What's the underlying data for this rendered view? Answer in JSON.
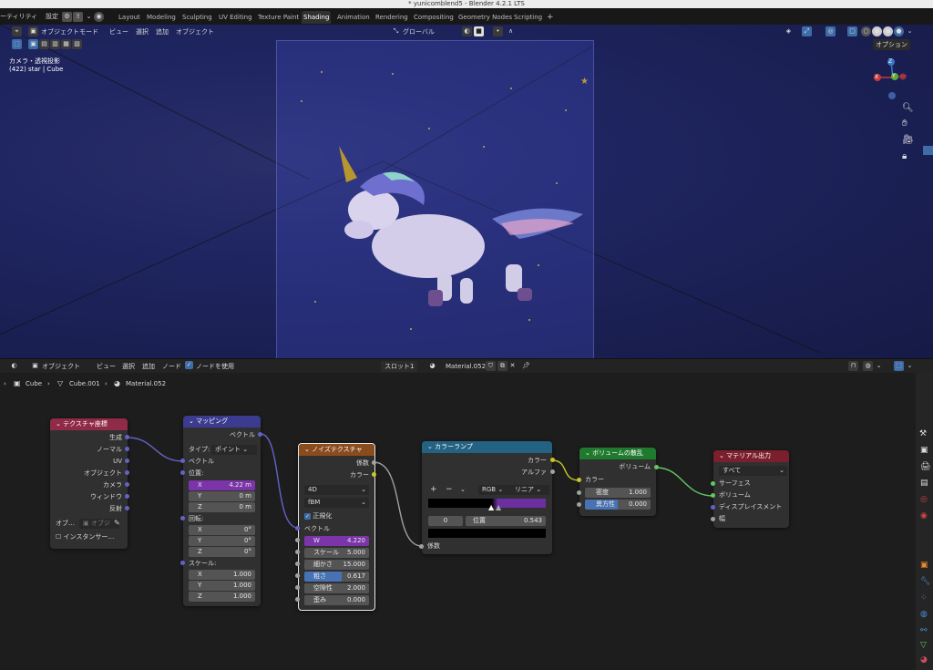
{
  "window": {
    "title": "* yunicomblend5 - Blender 4.2.1 LTS"
  },
  "menubar": {
    "items": [
      "ーティリティ",
      "設定"
    ],
    "workspaces": [
      "Layout",
      "Modeling",
      "Sculpting",
      "UV Editing",
      "Texture Paint",
      "Shading",
      "Animation",
      "Rendering",
      "Compositing",
      "Geometry Nodes",
      "Scripting"
    ],
    "active_workspace": "Shading",
    "add_tab": "+"
  },
  "viewport": {
    "mode": "オブジェクトモード",
    "menus": [
      "ビュー",
      "選択",
      "追加",
      "オブジェクト"
    ],
    "orientation": "グローバル",
    "options": "オプション",
    "overlay_text": [
      "カメラ・透視投影",
      "(422) star | Cube"
    ],
    "gizmo_axes": {
      "z": "Z",
      "x": "X",
      "y": "Y"
    }
  },
  "node_editor": {
    "header": {
      "mode": "オブジェクト",
      "menus": [
        "ビュー",
        "選択",
        "追加",
        "ノード"
      ],
      "use_nodes_label": "ノードを使用",
      "slot": "スロット1",
      "material": "Material.052"
    },
    "breadcrumb": [
      "Cube",
      "Cube.001",
      "Material.052"
    ],
    "nodes": {
      "texcoord": {
        "title": "テクスチャ座標",
        "outputs": [
          "生成",
          "ノーマル",
          "UV",
          "オブジェクト",
          "カメラ",
          "ウィンドウ",
          "反射"
        ],
        "object_label": "オブ…",
        "object_placeholder": "オブジ",
        "instancer": "インスタンサー…"
      },
      "mapping": {
        "title": "マッピング",
        "output": "ベクトル",
        "type_label": "タイプ:",
        "type_value": "ポイント",
        "vector_in": "ベクトル",
        "location_label": "位置:",
        "location": [
          [
            "X",
            "4.22 m"
          ],
          [
            "Y",
            "0 m"
          ],
          [
            "Z",
            "0 m"
          ]
        ],
        "rotation_label": "回転:",
        "rotation": [
          [
            "X",
            "0°"
          ],
          [
            "Y",
            "0°"
          ],
          [
            "Z",
            "0°"
          ]
        ],
        "scale_label": "スケール:",
        "scale": [
          [
            "X",
            "1.000"
          ],
          [
            "Y",
            "1.000"
          ],
          [
            "Z",
            "1.000"
          ]
        ]
      },
      "noise": {
        "title": "ノイズテクスチャ",
        "outputs": [
          "係数",
          "カラー"
        ],
        "dimensions": "4D",
        "type": "fBM",
        "normalize": "正規化",
        "vector_in": "ベクトル",
        "fields": [
          [
            "W",
            "4.220"
          ],
          [
            "スケール",
            "5.000"
          ],
          [
            "細かさ",
            "15.000"
          ],
          [
            "粗さ",
            "0.617"
          ],
          [
            "空隙性",
            "2.000"
          ],
          [
            "歪み",
            "0.000"
          ]
        ]
      },
      "colorramp": {
        "title": "カラーランプ",
        "outputs": [
          "カラー",
          "アルファ"
        ],
        "controls": [
          "+",
          "−",
          "⌄"
        ],
        "color_mode": "RGB",
        "interpolation": "リニア",
        "index": "0",
        "position_label": "位置",
        "position_value": "0.543",
        "fac_in": "係数"
      },
      "volume": {
        "title": "ボリュームの散乱",
        "output": "ボリューム",
        "color_in": "カラー",
        "fields": [
          [
            "密度",
            "1.000"
          ],
          [
            "異方性",
            "0.000"
          ]
        ]
      },
      "output": {
        "title": "マテリアル出力",
        "target": "すべて",
        "inputs": [
          "サーフェス",
          "ボリューム",
          "ディスプレイスメント",
          "幅"
        ]
      }
    }
  },
  "colors": {
    "texcoord_header": "#8f2a47",
    "mapping_header": "#3b3b8f",
    "noise_header": "#8a4b1d",
    "colorramp_header": "#246283",
    "volume_header": "#1f7a2e",
    "output_header": "#7a1f2b",
    "field_blue": "#4772b3",
    "field_purple": "#7b35a8"
  }
}
